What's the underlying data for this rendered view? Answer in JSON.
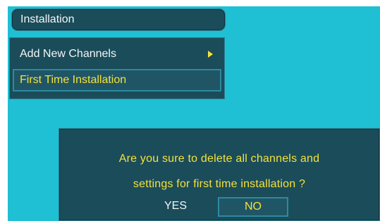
{
  "menu": {
    "title": "Installation",
    "items": [
      {
        "label": "Add New Channels",
        "has_submenu": true,
        "selected": false,
        "icon": "arrow-right-icon"
      },
      {
        "label": "First Time Installation",
        "has_submenu": false,
        "selected": true
      }
    ]
  },
  "dialog": {
    "line1": "Are you sure to delete all channels and",
    "line2": "settings for first time installation ?",
    "buttons": {
      "yes": "YES",
      "no": "NO"
    },
    "focused_button": "no"
  },
  "colors": {
    "background": "#1fbfd4",
    "panel": "#1b4c5a",
    "panel_border": "#2b7f92",
    "highlight_text": "#f4e23a",
    "normal_text": "#f3f6f7"
  }
}
